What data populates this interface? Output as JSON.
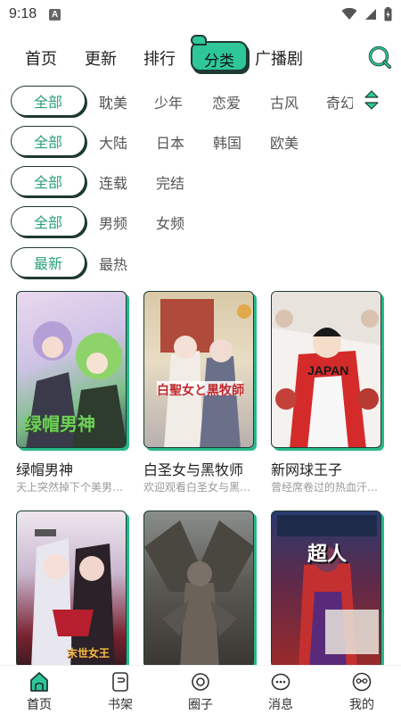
{
  "status": {
    "time": "9:18",
    "app_indicator": "A"
  },
  "top_tabs": [
    {
      "label": "首页"
    },
    {
      "label": "更新"
    },
    {
      "label": "排行"
    },
    {
      "label": "分类",
      "active": true
    },
    {
      "label": "广播剧"
    }
  ],
  "filters": [
    {
      "selected": "全部",
      "options": [
        "耽美",
        "少年",
        "恋爱",
        "古风",
        "奇幻"
      ]
    },
    {
      "selected": "全部",
      "options": [
        "大陆",
        "日本",
        "韩国",
        "欧美"
      ]
    },
    {
      "selected": "全部",
      "options": [
        "连载",
        "完结"
      ]
    },
    {
      "selected": "全部",
      "options": [
        "男频",
        "女频"
      ]
    },
    {
      "selected": "最新",
      "options": [
        "最热"
      ]
    }
  ],
  "comics": [
    {
      "title": "绿帽男神",
      "desc": "天上突然掉下个美男…",
      "cover_text": "绿帽男神"
    },
    {
      "title": "白圣女与黑牧师",
      "desc": "欢迎观看白圣女与黑…",
      "cover_text": "白聖女と黒牧師"
    },
    {
      "title": "新网球王子",
      "desc": "曾经席卷过的热血汗…",
      "cover_text": "JAPAN"
    },
    {
      "title": "",
      "desc": "",
      "cover_text": "末世女王"
    },
    {
      "title": "",
      "desc": "",
      "cover_text": ""
    },
    {
      "title": "",
      "desc": "",
      "cover_text": "超人"
    }
  ],
  "bottom_nav": [
    {
      "label": "首页",
      "icon": "home-icon",
      "active": true
    },
    {
      "label": "书架",
      "icon": "bookshelf-icon"
    },
    {
      "label": "圈子",
      "icon": "circle-icon"
    },
    {
      "label": "消息",
      "icon": "message-icon"
    },
    {
      "label": "我的",
      "icon": "profile-icon"
    }
  ],
  "colors": {
    "accent": "#2fc79a",
    "accent_text": "#2aa07c",
    "outline": "#1e3a32"
  }
}
